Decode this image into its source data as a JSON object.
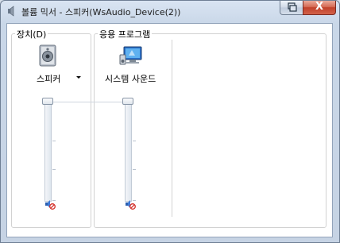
{
  "window": {
    "title": "볼륨 믹서 - 스피커(WsAudio_Device(2))",
    "close_label": "X"
  },
  "device_group": {
    "title": "장치(D)",
    "device_name": "스피커"
  },
  "apps_group": {
    "title": "응용 프로그램",
    "app_name": "시스템 사운드"
  },
  "icons": {
    "title": "speaker-app-icon",
    "device": "speaker-device-icon",
    "app": "system-sounds-icon",
    "mute": "muted-speaker-icon"
  },
  "sliders": {
    "device_volume_percent": 100,
    "app_volume_percent": 100,
    "device_muted": true,
    "app_muted": true
  },
  "colors": {
    "close_button": "#c1412a",
    "mute_badge": "#d4302a"
  }
}
